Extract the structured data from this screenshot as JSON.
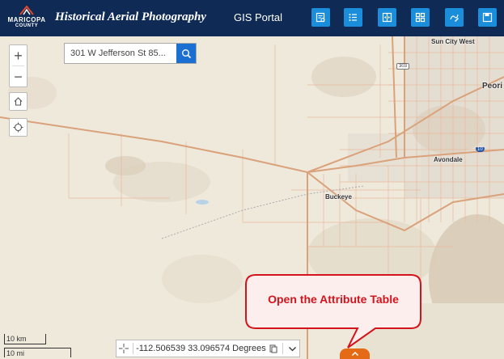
{
  "header": {
    "logo_line1": "MARICOPA",
    "logo_line2": "COUNTY",
    "title": "Historical Aerial Photography",
    "portal_link": "GIS Portal",
    "buttons": [
      "legend-list-icon",
      "layer-list-icon",
      "swipe-icon",
      "basemap-gallery-icon",
      "edit-draw-icon",
      "save-icon"
    ]
  },
  "search": {
    "value": "301 W Jefferson St 85...",
    "icon": "search-icon"
  },
  "map_labels": {
    "sun_city_west": "Sun City West",
    "peoria": "Peori",
    "avondale": "Avondale",
    "buckeye": "Buckeye",
    "route_303": "303",
    "interstate_10": "10"
  },
  "scale": {
    "km": "10 km",
    "mi": "10 mi"
  },
  "coordinates": {
    "text": "-112.506539 33.096574 Degrees"
  },
  "callout": {
    "text": "Open the Attribute Table"
  },
  "colors": {
    "header_bg": "#0f2a55",
    "button_bg": "#1a8ddb",
    "accent_orange": "#e46a16",
    "callout_text": "#d4141c"
  }
}
